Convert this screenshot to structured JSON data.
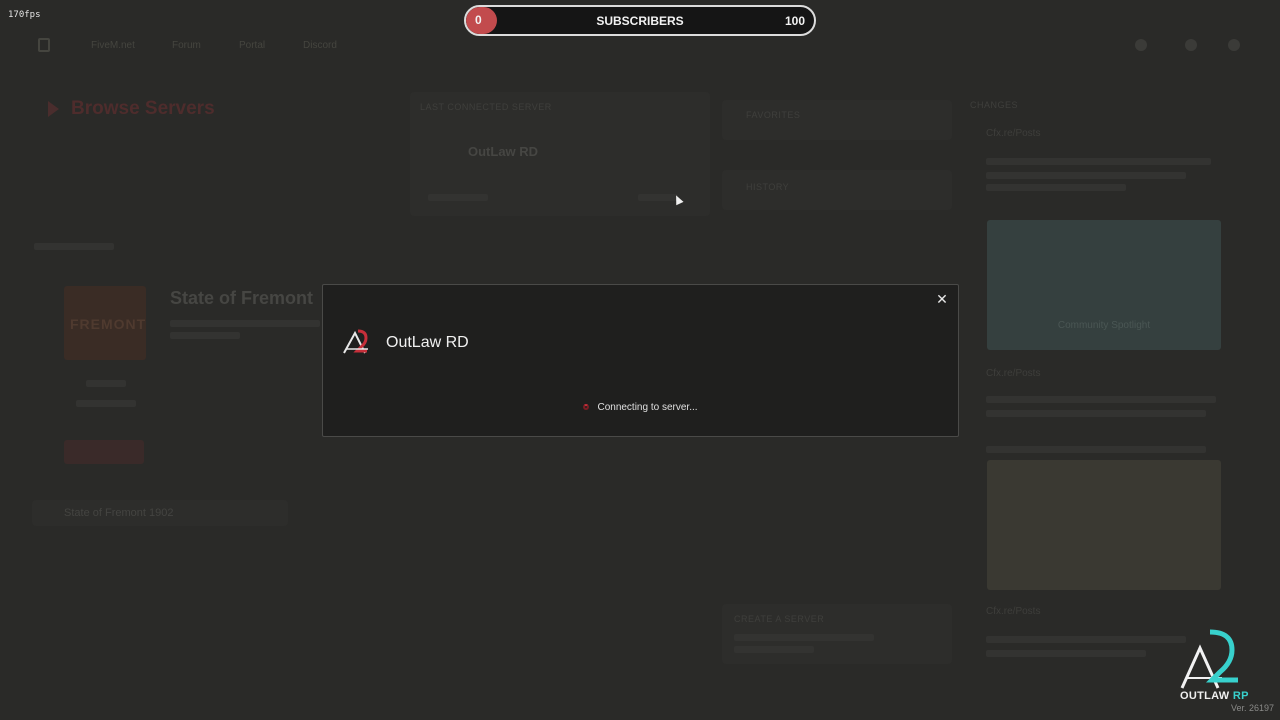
{
  "overlay": {
    "fps": "170fps",
    "subscribers": {
      "label": "SUBSCRIBERS",
      "min": "0",
      "max": "100",
      "progress": 0.09,
      "fill_color": "#c24b4d"
    }
  },
  "topnav": {
    "links": [
      "FiveM.net",
      "Forum",
      "Portal",
      "Discord"
    ]
  },
  "browse": {
    "title": "Browse Servers",
    "accent": "#c62f3a"
  },
  "last_connected": {
    "heading": "LAST CONNECTED SERVER",
    "server_name": "OutLaw RD"
  },
  "side_tabs": {
    "favorites": "FAVORITES",
    "history": "HISTORY"
  },
  "promoted": {
    "server_name": "State of Fremont",
    "card_text": "FREMONT",
    "list_item": "State of Fremont 1902"
  },
  "feed": {
    "header": "CHANGES",
    "posts": [
      {
        "author": "Cfx.re/Posts"
      },
      {
        "author": "Cfx.re/Posts"
      },
      {
        "author": "Cfx.re/Posts"
      }
    ],
    "spotlight": "Community Spotlight"
  },
  "create_server": {
    "heading": "CREATE A SERVER"
  },
  "modal": {
    "server_name": "OutLaw RD",
    "status": "Connecting to server...",
    "close_glyph": "✕"
  },
  "branding": {
    "name_a": "OUTLAW",
    "name_b": "RP",
    "version": "Ver. 26197",
    "accent": "#38d1cd"
  }
}
